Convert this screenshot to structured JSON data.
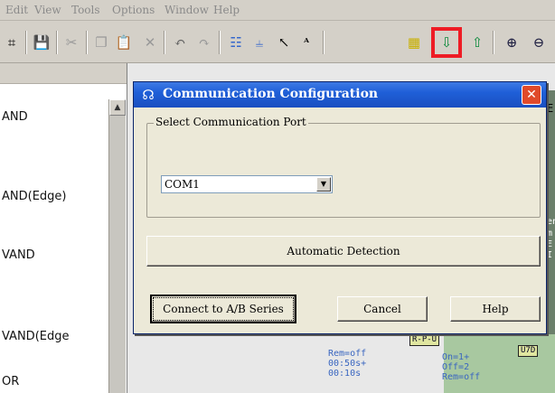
{
  "menu": {
    "items": [
      "Edit",
      "View",
      "Tools",
      "Options",
      "Window",
      "Help"
    ]
  },
  "toolbar": {
    "buttons": [
      {
        "icon": "open-icon",
        "glyph": "⌗"
      },
      {
        "icon": "save-icon",
        "glyph": "💾"
      },
      {
        "icon": "cut-icon",
        "glyph": "✂"
      },
      {
        "icon": "copy-icon",
        "glyph": "❐"
      },
      {
        "icon": "paste-icon",
        "glyph": "📋"
      },
      {
        "icon": "delete-icon",
        "glyph": "✕"
      },
      {
        "icon": "undo-icon",
        "glyph": "↶"
      },
      {
        "icon": "redo-icon",
        "glyph": "↷"
      },
      {
        "icon": "network-icon",
        "glyph": "☷"
      },
      {
        "icon": "split-icon",
        "glyph": "⫨"
      },
      {
        "icon": "select-arrow-icon",
        "glyph": "↖"
      },
      {
        "icon": "text-arrow-icon",
        "glyph": "ᴬ"
      },
      {
        "icon": "monitor-icon",
        "glyph": "▦"
      },
      {
        "icon": "download-icon",
        "glyph": "⇩"
      },
      {
        "icon": "upload-icon",
        "glyph": "⇧"
      },
      {
        "icon": "zoom-in-icon",
        "glyph": "⊕"
      },
      {
        "icon": "zoom-out-icon",
        "glyph": "⊖"
      }
    ],
    "highlight_color": "#ee1c25"
  },
  "left_panel": {
    "items": [
      "AND",
      "AND(Edge)",
      "VAND",
      "VAND(Edge",
      "OR"
    ]
  },
  "ladder": {
    "box1": "R-P-U",
    "box2": "U7D",
    "text1": "Rem=off\n00:50s+\n00:10s",
    "text2": "On=1+\nOff=2\nRem=off",
    "side_fragments": [
      "E",
      "en",
      "m",
      "E",
      "I"
    ]
  },
  "dialog": {
    "title": "Communication Configuration",
    "close_glyph": "✕",
    "group_label": "Select Communication Port",
    "port_value": "COM1",
    "auto_detect_label": "Automatic Detection",
    "connect_label": "Connect to A/B Series",
    "cancel_label": "Cancel",
    "help_label": "Help",
    "titlebar_color": "#1f5fd8"
  }
}
